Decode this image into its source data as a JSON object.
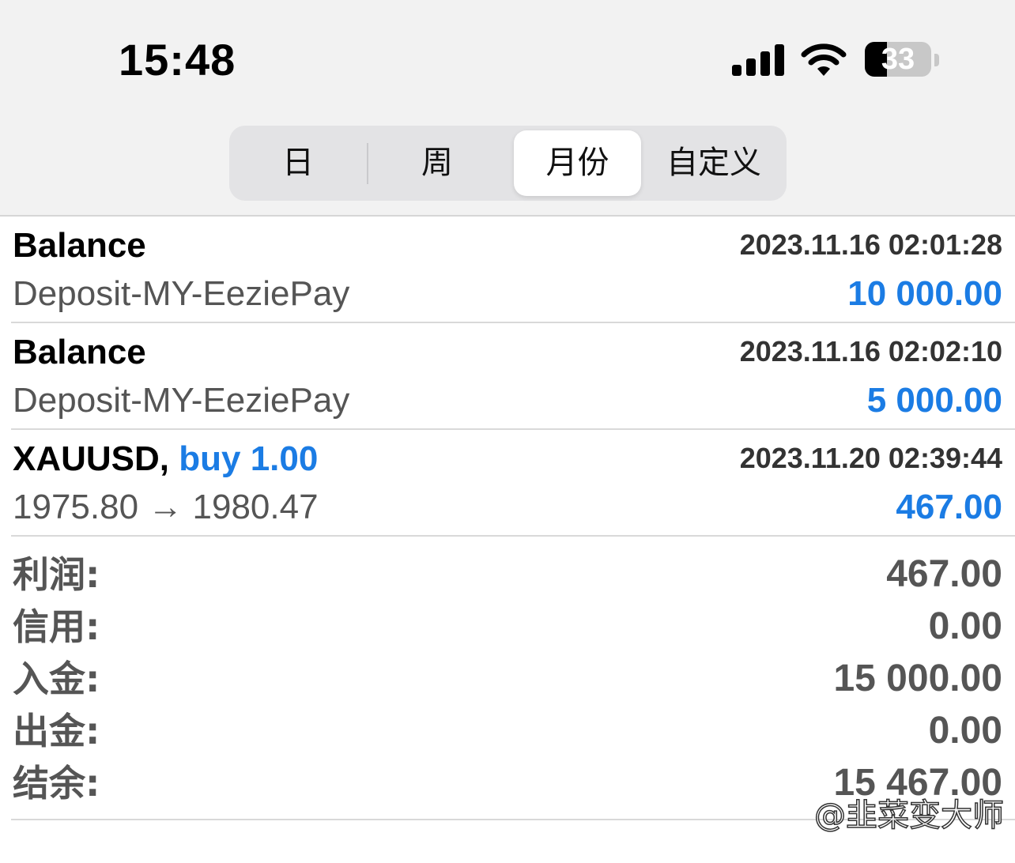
{
  "status_bar": {
    "time": "15:48",
    "battery_level": "33",
    "icons": [
      "cellular-signal-icon",
      "wifi-icon",
      "battery-icon"
    ]
  },
  "period_tabs": {
    "items": [
      {
        "label": "日",
        "selected": false
      },
      {
        "label": "周",
        "selected": false
      },
      {
        "label": "月份",
        "selected": true
      },
      {
        "label": "自定义",
        "selected": false
      }
    ]
  },
  "transactions": [
    {
      "title": "Balance",
      "time": "2023.11.16 02:01:28",
      "subtitle": "Deposit-MY-EeziePay",
      "amount": "10 000.00"
    },
    {
      "title": "Balance",
      "time": "2023.11.16 02:02:10",
      "subtitle": "Deposit-MY-EeziePay",
      "amount": "5 000.00"
    },
    {
      "symbol": "XAUUSD,",
      "trade_type": "buy 1.00",
      "time": "2023.11.20 02:39:44",
      "subtitle": "1975.80 → 1980.47",
      "amount": "467.00"
    }
  ],
  "summary": {
    "profit": {
      "label": "利润:",
      "value": "467.00"
    },
    "credit": {
      "label": "信用:",
      "value": "0.00"
    },
    "deposit": {
      "label": "入金:",
      "value": "15 000.00"
    },
    "withdrawal": {
      "label": "出金:",
      "value": "0.00"
    },
    "balance": {
      "label": "结余:",
      "value": "15 467.00"
    }
  },
  "watermark": "@韭菜变大师",
  "colors": {
    "accent_blue": "#1b7ce4",
    "header_bg": "#f2f2f2",
    "segmented_bg": "#e3e3e5",
    "muted_text": "#555555"
  }
}
